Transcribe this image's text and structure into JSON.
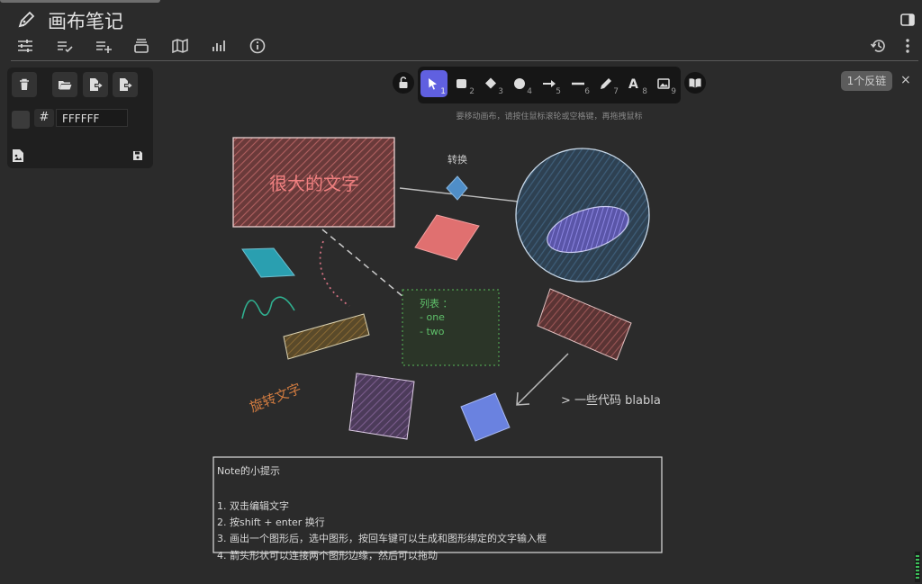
{
  "app": {
    "title": "画布笔记"
  },
  "header": {
    "icons": [
      "pen-icon",
      "sliders-icon",
      "checklist-icon",
      "list-add-icon",
      "archive-icon",
      "map-icon",
      "chart-icon",
      "info-icon",
      "history-icon",
      "more-icon",
      "sidebar-toggle-icon"
    ]
  },
  "panel": {
    "buttons": [
      "trash-icon",
      "folder-open-icon",
      "export-icon",
      "export-share-icon"
    ],
    "color_hash": "#",
    "color_value": "FFFFFF",
    "bottom_icons": [
      "image-icon",
      "save-icon"
    ]
  },
  "tools": [
    {
      "name": "select",
      "num": "1"
    },
    {
      "name": "rectangle",
      "num": "2"
    },
    {
      "name": "diamond",
      "num": "3"
    },
    {
      "name": "ellipse",
      "num": "4"
    },
    {
      "name": "arrow",
      "num": "5"
    },
    {
      "name": "line",
      "num": "6"
    },
    {
      "name": "draw",
      "num": "7"
    },
    {
      "name": "text",
      "num": "8"
    },
    {
      "name": "image",
      "num": "9"
    }
  ],
  "backlinks": "1个反链",
  "close": "×",
  "hint": "要移动画布，请按住鼠标滚轮或空格键，再拖拽鼠标",
  "canvas": {
    "big_text": "很大的文字",
    "convert_label": "转换",
    "list_title": "列表 ：",
    "list_items": [
      "- one",
      "- two"
    ],
    "rotated_text": "旋转文字",
    "code_text": "> 一些代码 blabla",
    "note_title": "Note的小提示",
    "note_lines": [
      "1. 双击编辑文字",
      "2. 按shift + enter 换行",
      "3. 画出一个图形后，选中图形，按回车键可以生成和图形绑定的文字输入框",
      "4. 箭头形状可以连接两个图形边缘，然后可以拖动"
    ]
  },
  "colors": {
    "accent": "#6060e0",
    "bg": "#2b2b2b"
  }
}
